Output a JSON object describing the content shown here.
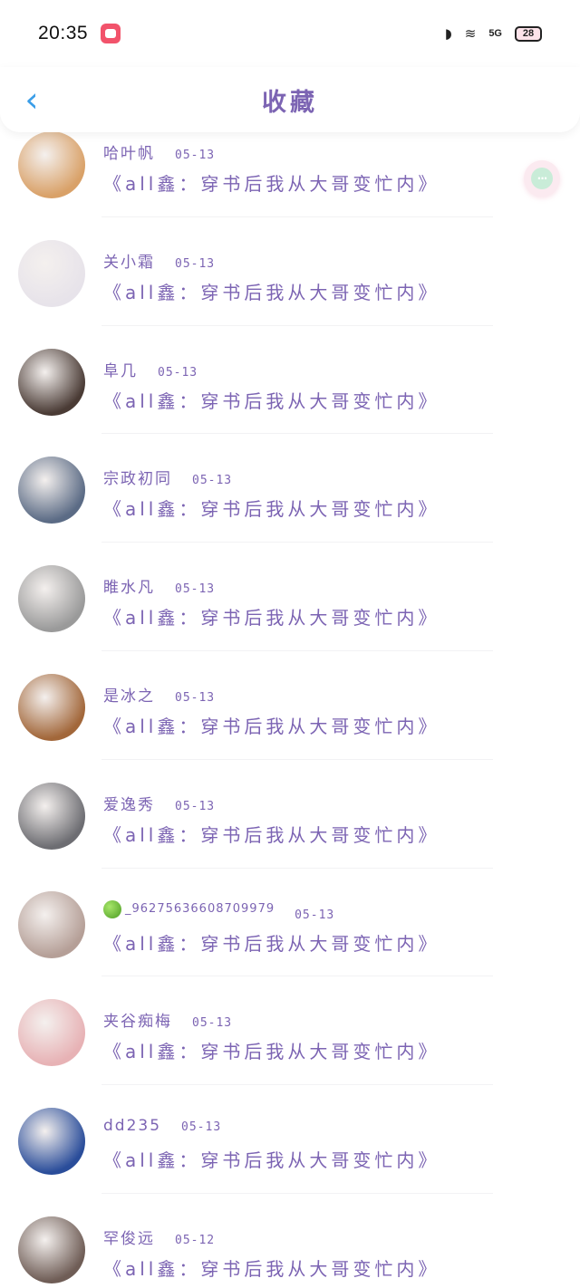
{
  "status_bar": {
    "time": "20:35",
    "network": "5G",
    "battery": "28"
  },
  "header": {
    "title": "收藏",
    "back_icon": "chevron-left-icon"
  },
  "more_button": {
    "icon": "more-dots-icon",
    "label": "···"
  },
  "items": [
    {
      "user": "哈叶帆",
      "date": "05-13",
      "title": "《all鑫：穿书后我从大哥变忙内》",
      "avatar_color": "#d9a168"
    },
    {
      "user": "关小霜",
      "date": "05-13",
      "title": "《all鑫：穿书后我从大哥变忙内》",
      "avatar_color": "#e7e3ea"
    },
    {
      "user": "阜几",
      "date": "05-13",
      "title": "《all鑫：穿书后我从大哥变忙内》",
      "avatar_color": "#4a3b35"
    },
    {
      "user": "宗政初同",
      "date": "05-13",
      "title": "《all鑫：穿书后我从大哥变忙内》",
      "avatar_color": "#5b6b85"
    },
    {
      "user": "睢水凡",
      "date": "05-13",
      "title": "《all鑫：穿书后我从大哥变忙内》",
      "avatar_color": "#9a9a9a"
    },
    {
      "user": "是冰之",
      "date": "05-13",
      "title": "《all鑫：穿书后我从大哥变忙内》",
      "avatar_color": "#a2673a"
    },
    {
      "user": "爱逸秀",
      "date": "05-13",
      "title": "《all鑫：穿书后我从大哥变忙内》",
      "avatar_color": "#6d6d72"
    },
    {
      "user": "_96275636608709979",
      "date": "05-13",
      "title": "《all鑫：穿书后我从大哥变忙内》",
      "avatar_color": "#b59f97",
      "has_apple": true
    },
    {
      "user": "夹谷痴梅",
      "date": "05-13",
      "title": "《all鑫：穿书后我从大哥变忙内》",
      "avatar_color": "#e7b2b5"
    },
    {
      "user": "dd235",
      "date": "05-13",
      "title": "《all鑫：穿书后我从大哥变忙内》",
      "avatar_color": "#2a4d9a"
    },
    {
      "user": "罕俊远",
      "date": "05-12",
      "title": "《all鑫：穿书后我从大哥变忙内》",
      "avatar_color": "#6f5d56"
    }
  ]
}
